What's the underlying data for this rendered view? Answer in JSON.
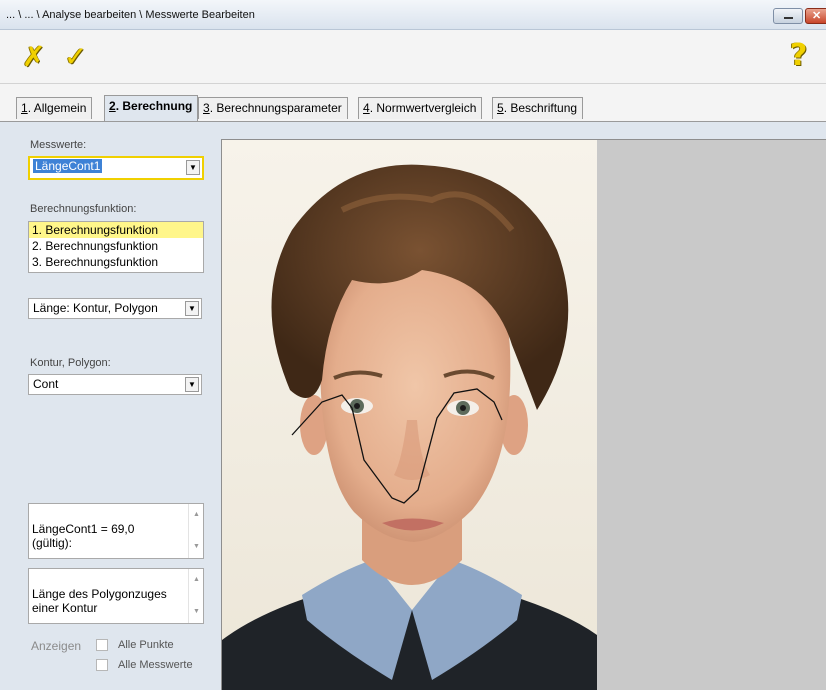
{
  "window": {
    "title": "... \\ ... \\ Analyse bearbeiten \\ Messwerte Bearbeiten"
  },
  "toolbar": {
    "cancel_icon": "✗",
    "ok_icon": "✓",
    "help_icon": "?"
  },
  "tabs": [
    {
      "key": "1",
      "label": ". Allgemein"
    },
    {
      "key": "2",
      "label": ". Berechnung"
    },
    {
      "key": "3",
      "label": ". Berechnungsparameter"
    },
    {
      "key": "4",
      "label": ". Normwertvergleich"
    },
    {
      "key": "5",
      "label": ". Beschriftung"
    }
  ],
  "form": {
    "messwerte_label": "Messwerte:",
    "messwerte_value": "LängeCont1",
    "berechnungsfunktion_label": "Berechnungsfunktion:",
    "funktionen": [
      "1. Berechnungsfunktion",
      "2. Berechnungsfunktion",
      "3. Berechnungsfunktion"
    ],
    "typ_value": "Länge: Kontur, Polygon",
    "kontur_label": "Kontur, Polygon:",
    "kontur_value": "Cont",
    "result_text": "LängeCont1 = 69,0\n(gültig):",
    "description_text": "Länge des Polygonzuges\neiner Kontur",
    "anzeigen_label": "Anzeigen",
    "alle_punkte_label": "Alle Punkte",
    "alle_messwerte_label": "Alle Messwerte"
  },
  "colors": {
    "accent_yellow": "#f0d000",
    "selection_blue": "#3e82d6",
    "list_selection": "#fff68a"
  }
}
